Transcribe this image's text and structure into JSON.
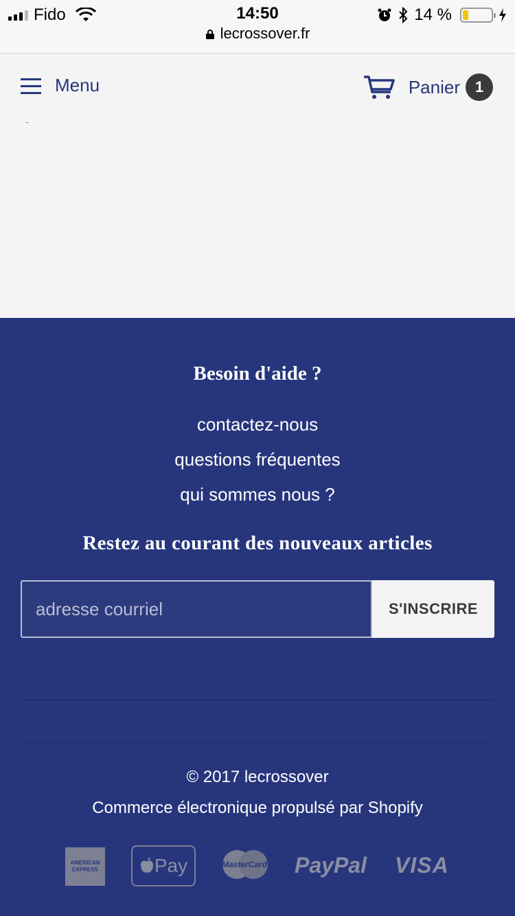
{
  "status_bar": {
    "carrier": "Fido",
    "time": "14:50",
    "url": "lecrossover.fr",
    "battery": "14 %"
  },
  "header": {
    "menu_label": "Menu",
    "cart_label": "Panier",
    "cart_count": "1"
  },
  "footer": {
    "help_title": "Besoin d'aide ?",
    "links": [
      "contactez-nous",
      "questions fréquentes",
      "qui sommes nous ?"
    ],
    "newsletter_title": "Restez au courant des nouveaux articles",
    "email_placeholder": "adresse courriel",
    "subscribe_label": "S'INSCRIRE",
    "copyright": "© 2017 lecrossover",
    "powered_by": "Commerce électronique propulsé par Shopify",
    "payment_methods": {
      "amex": "AMERICAN EXPRESS",
      "applepay": "Pay",
      "mastercard": "MasterCard",
      "paypal": "PayPal",
      "visa": "VISA"
    }
  },
  "colors": {
    "brand_blue": "#27367c",
    "background": "#f4f4f4"
  }
}
